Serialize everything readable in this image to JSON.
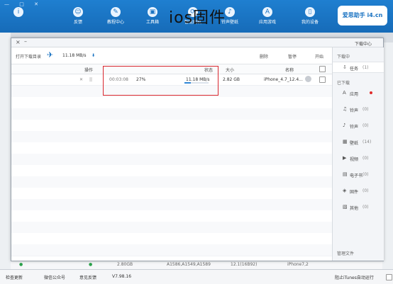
{
  "title_overlay": "ios固件",
  "topbar": {
    "window_controls": "— □ ✕",
    "nav": [
      {
        "label": "我的设备",
        "icon": "device-icon"
      },
      {
        "label": "应用游戏",
        "icon": "apps-icon"
      },
      {
        "label": "铃声壁纸",
        "icon": "ringtone-icon"
      },
      {
        "label": "智能刷机",
        "icon": "flash-icon"
      },
      {
        "label": "工具箱",
        "icon": "toolbox-icon"
      },
      {
        "label": "教程中心",
        "icon": "tutorial-icon"
      },
      {
        "label": "反馈",
        "icon": "feedback-icon"
      }
    ],
    "logo": "爱思助手 i4.cn"
  },
  "dialog": {
    "title": "下载中心",
    "toolbar": {
      "start": "开始",
      "pause": "暂停",
      "delete": "删除",
      "speed": "11.18 MB/s",
      "open_folder": "打开下载目录"
    },
    "columns": {
      "name": "名称",
      "size": "大小",
      "status": "状态",
      "action": "操作"
    },
    "rows": [
      {
        "name": "iPhone_4.7_12.4...",
        "size": "2.82 GB",
        "speed": "11.18 MB/s",
        "percent": "27%",
        "progress": 0.27,
        "elapsed": "00:03:08",
        "pause_icon": "||",
        "close_icon": "✕"
      }
    ],
    "sidebar": {
      "section_downloading": "下载中",
      "section_downloaded": "已下载",
      "items": [
        {
          "label": "任务",
          "count": "(1)",
          "icon": "task-icon"
        },
        {
          "label": "应用",
          "count": "",
          "icon": "app-icon"
        },
        {
          "label": "铃声",
          "count": "(0)",
          "icon": "ringtone-icon"
        },
        {
          "label": "铃声",
          "count": "(0)",
          "icon": "bell-icon"
        },
        {
          "label": "壁纸",
          "count": "(14)",
          "icon": "wallpaper-icon"
        },
        {
          "label": "视频",
          "count": "(0)",
          "icon": "video-icon"
        },
        {
          "label": "电子书",
          "count": "(0)",
          "icon": "ebook-icon"
        },
        {
          "label": "固件",
          "count": "(0)",
          "icon": "firmware-icon"
        },
        {
          "label": "其他",
          "count": "(0)",
          "icon": "other-icon"
        }
      ],
      "bottom": "管理文件"
    }
  },
  "background_row": {
    "model": "iPhone7,2",
    "version": "12.1(16B92)",
    "codes": "A1586,A1549,A1589",
    "size": "2.80GB"
  },
  "statusbar": {
    "itunes": "阻止iTunes自动运行",
    "version": "V7.98.16",
    "feedback": "意见反馈",
    "wechat": "微信公众号",
    "update": "检查更新"
  }
}
